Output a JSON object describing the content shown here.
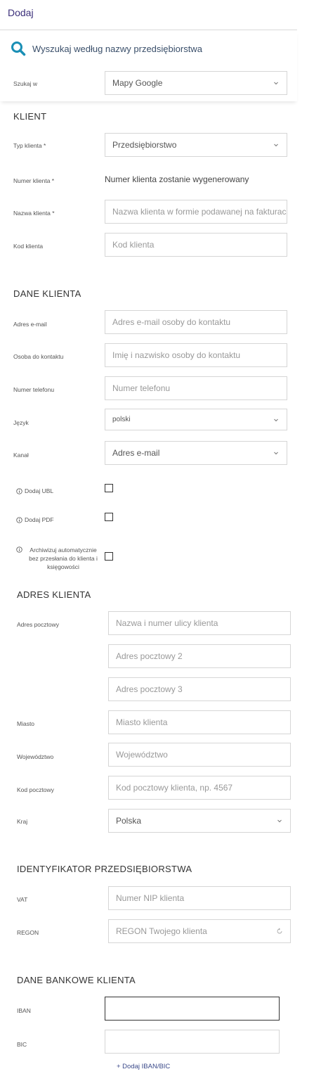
{
  "header": {
    "title": "Dodaj"
  },
  "search": {
    "link_label": "Wyszukaj według nazwy przedsiębiorstwa",
    "search_in_label": "Szukaj w",
    "search_in_value": "Mapy Google"
  },
  "client": {
    "section_title": "KLIENT",
    "type_label": "Typ klienta *",
    "type_value": "Przedsiębiorstwo",
    "number_label": "Numer klienta *",
    "number_value": "Numer klienta zostanie wygenerowany",
    "name_label": "Nazwa klienta *",
    "name_placeholder": "Nazwa klienta w formie podawanej na fakturach",
    "code_label": "Kod klienta",
    "code_placeholder": "Kod klienta"
  },
  "client_data": {
    "section_title": "DANE KLIENTA",
    "email_label": "Adres e-mail",
    "email_placeholder": "Adres e-mail osoby do kontaktu",
    "contact_label": "Osoba do kontaktu",
    "contact_placeholder": "Imię i nazwisko osoby do kontaktu",
    "phone_label": "Numer telefonu",
    "phone_placeholder": "Numer telefonu",
    "language_label": "Język",
    "language_value": "polski",
    "channel_label": "Kanał",
    "channel_value": "Adres e-mail",
    "ubl_label": "Dodaj UBL",
    "pdf_label": "Dodaj PDF",
    "archive_label": "Archiwizuj automatycznie bez przesłania do klienta i księgowości"
  },
  "address": {
    "section_title": "ADRES KLIENTA",
    "postal_label": "Adres pocztowy",
    "street_placeholder": "Nazwa i numer ulicy klienta",
    "postal2_placeholder": "Adres pocztowy 2",
    "postal3_placeholder": "Adres pocztowy 3",
    "city_label": "Miasto",
    "city_placeholder": "Miasto klienta",
    "province_label": "Województwo",
    "province_placeholder": "Województwo",
    "zip_label": "Kod pocztowy",
    "zip_placeholder": "Kod pocztowy klienta, np. 4567",
    "country_label": "Kraj",
    "country_value": "Polska"
  },
  "company_id": {
    "section_title": "IDENTYFIKATOR PRZEDSIĘBIORSTWA",
    "vat_label": "VAT",
    "vat_placeholder": "Numer NIP klienta",
    "regon_label": "REGON",
    "regon_placeholder": "REGON Twojego klienta"
  },
  "bank": {
    "section_title": "DANE BANKOWE KLIENTA",
    "iban_label": "IBAN",
    "iban_value": "",
    "bic_label": "BIC",
    "bic_value": "",
    "add_link": "+ Dodaj IBAN/BIC"
  },
  "colors": {
    "accent": "#1a8fb5",
    "header_text": "#3b2f7a",
    "link": "#3b4a8a"
  },
  "icons": {
    "search": "search-icon",
    "chevron": "chevron-down-icon",
    "info": "info-icon",
    "refresh": "refresh-icon"
  }
}
